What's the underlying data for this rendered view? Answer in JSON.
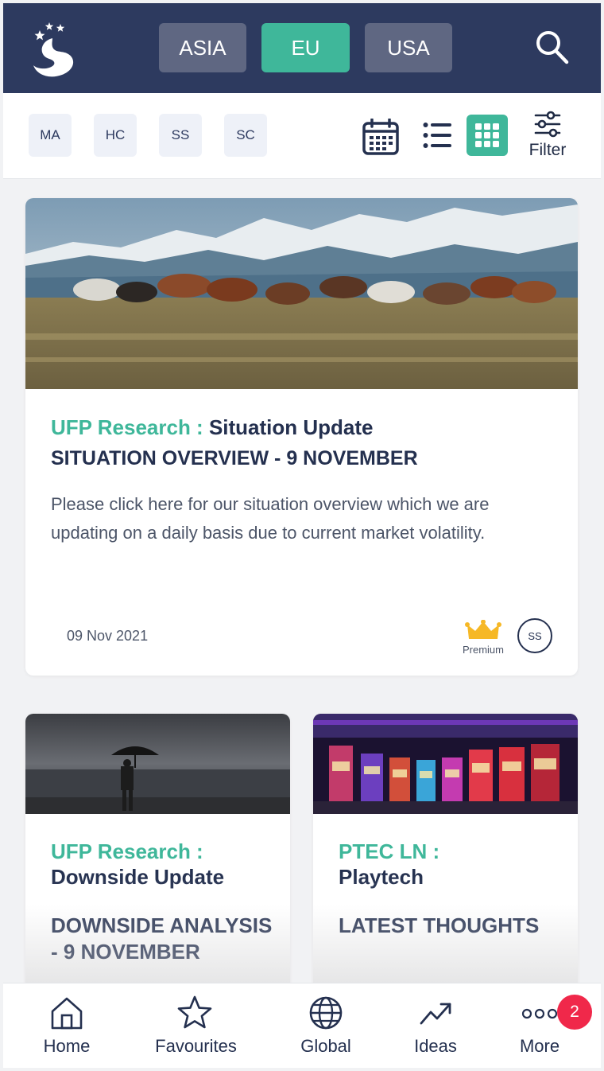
{
  "header": {
    "regions": [
      {
        "label": "ASIA",
        "active": false
      },
      {
        "label": "EU",
        "active": true
      },
      {
        "label": "USA",
        "active": false
      }
    ],
    "colors": {
      "bar": "#2d3a5f",
      "active": "#3fb79a",
      "inactive": "#5f6782"
    }
  },
  "filters": {
    "chips": [
      "MA",
      "HC",
      "SS",
      "SC"
    ],
    "filter_label": "Filter",
    "view_modes": [
      "calendar-icon",
      "list-icon",
      "grid-icon"
    ],
    "active_view": "grid"
  },
  "featured": {
    "source": "UFP Research :",
    "category": "Situation Update",
    "title": "SITUATION OVERVIEW - 9 NOVEMBER",
    "description": "Please click here for our situation overview which we are updating on a daily basis due to current market volatility.",
    "date": "09 Nov 2021",
    "premium_label": "Premium",
    "tag": "SS"
  },
  "cards": [
    {
      "source": "UFP Research :",
      "category": "Downside Update",
      "title": "DOWNSIDE ANALYSIS - 9 NOVEMBER"
    },
    {
      "source": "PTEC LN :",
      "category": "Playtech",
      "title": "LATEST THOUGHTS"
    }
  ],
  "bottom_nav": {
    "items": [
      {
        "label": "Home",
        "icon": "home-icon"
      },
      {
        "label": "Favourites",
        "icon": "star-icon"
      },
      {
        "label": "Global",
        "icon": "globe-icon"
      },
      {
        "label": "Ideas",
        "icon": "trend-up-icon"
      },
      {
        "label": "More",
        "icon": "more-dots-icon"
      }
    ],
    "more_badge": "2"
  }
}
